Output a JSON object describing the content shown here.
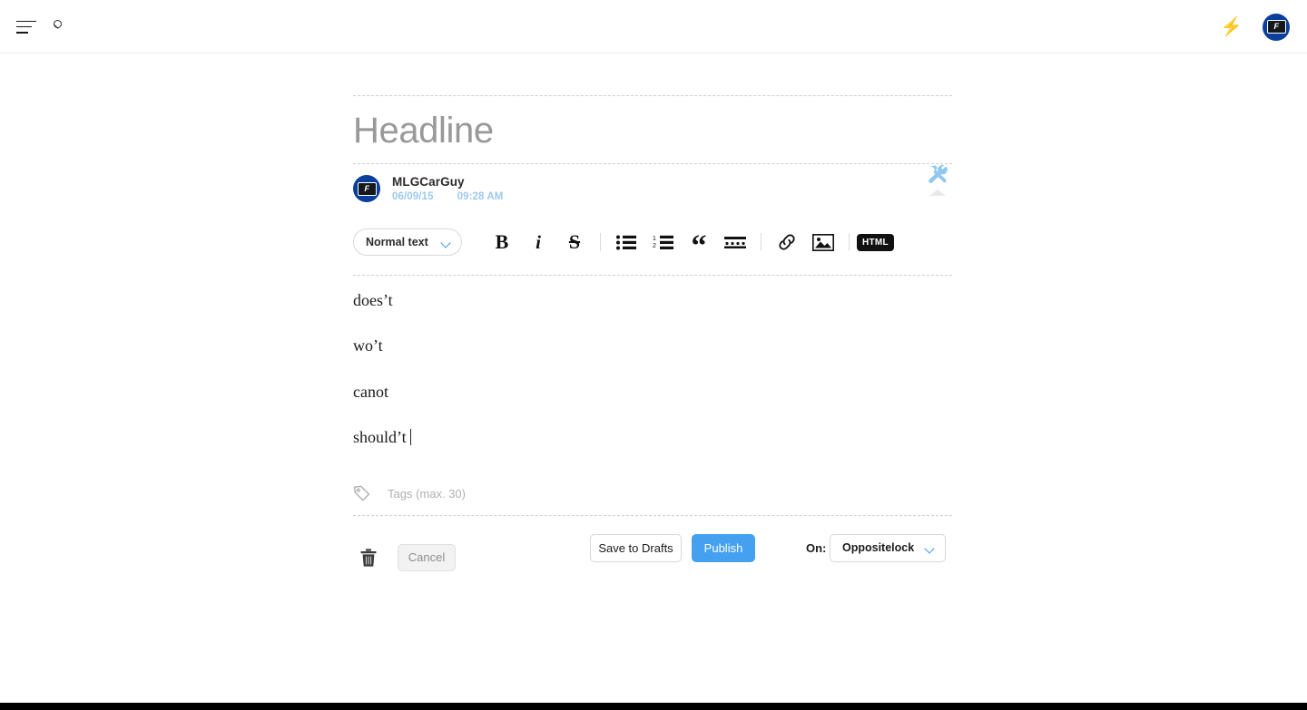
{
  "topbar": {
    "menu_icon": "hamburger-icon",
    "search_icon": "search-icon",
    "bolt_icon": "lightning-bolt-icon",
    "bolt_glyph": "⚡",
    "avatar_initial": "F",
    "avatar_color": "#0b3f9c"
  },
  "editor": {
    "headline_placeholder": "Headline",
    "author": {
      "name": "MLGCarGuy",
      "date": "06/09/15",
      "time": "09:28 AM",
      "avatar_initial": "F"
    },
    "tools_icon": "tools-icon",
    "toolbar": {
      "style_select_value": "Normal text",
      "buttons": [
        {
          "name": "bold-button",
          "glyph": "B"
        },
        {
          "name": "italic-button",
          "glyph": "i"
        },
        {
          "name": "strikethrough-button",
          "glyph": "S"
        },
        {
          "name": "bulleted-list-button",
          "glyph": ""
        },
        {
          "name": "numbered-list-button",
          "glyph": ""
        },
        {
          "name": "blockquote-button",
          "glyph": "“"
        },
        {
          "name": "divider-button",
          "glyph": ""
        },
        {
          "name": "link-button",
          "glyph": ""
        },
        {
          "name": "image-button",
          "glyph": ""
        },
        {
          "name": "html-button",
          "glyph": "HTML"
        }
      ],
      "html_label": "HTML",
      "blockquote_glyph": "“"
    },
    "body_paragraphs": [
      "does’t",
      "wo’t",
      "canot",
      "should’t"
    ],
    "tags_placeholder": "Tags (max. 30)"
  },
  "actions": {
    "cancel_label": "Cancel",
    "save_drafts_label": "Save to Drafts",
    "publish_label": "Publish",
    "on_label": "On:",
    "blog_value": "Oppositelock",
    "publish_color": "#45a1ef"
  }
}
